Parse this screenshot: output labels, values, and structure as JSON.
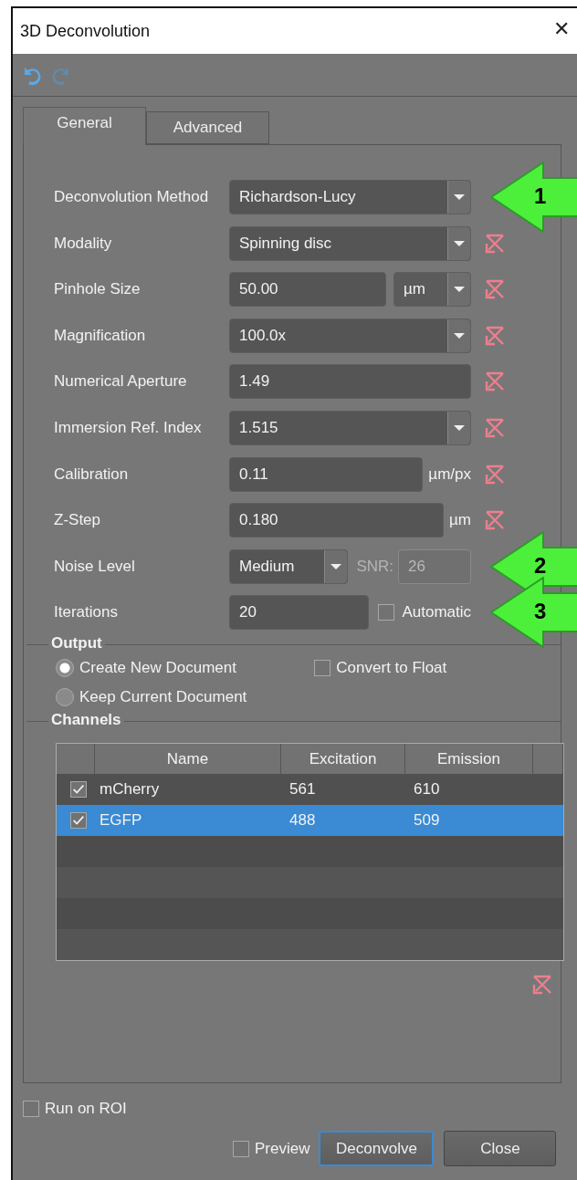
{
  "window": {
    "title": "3D Deconvolution",
    "close_label": "✕"
  },
  "toolbar": [
    {
      "kind": "undo",
      "disabled": false
    },
    {
      "kind": "redo",
      "disabled": true
    }
  ],
  "tabs": [
    {
      "label": "General",
      "selected": true
    },
    {
      "label": "Advanced",
      "selected": false
    }
  ],
  "rows": [
    {
      "label": "Deconvolution Method",
      "kind": "combo",
      "value": "Richardson-Lucy",
      "reset": false,
      "callout": "1"
    },
    {
      "label": "Modality",
      "kind": "combo",
      "value": "Spinning disc",
      "reset": true
    },
    {
      "label": "Pinhole Size",
      "kind": "input_unit_combo",
      "value": "50.00",
      "unit": "µm",
      "reset": true
    },
    {
      "label": "Magnification",
      "kind": "combo",
      "value": "100.0x",
      "reset": true
    },
    {
      "label": "Numerical Aperture",
      "kind": "input",
      "value": "1.49",
      "reset": true
    },
    {
      "label": "Immersion Ref. Index",
      "kind": "combo",
      "value": "1.515",
      "reset": true
    },
    {
      "label": "Calibration",
      "kind": "input_unit",
      "value": "0.11",
      "unit": "µm/px",
      "reset": true
    },
    {
      "label": "Z-Step",
      "kind": "input_unit",
      "value": "0.180",
      "unit": "µm",
      "reset": true
    },
    {
      "label": "Noise Level",
      "kind": "noise",
      "value": "Medium",
      "snr_label": "SNR:",
      "snr_value": "26",
      "snr_disabled": true,
      "reset": false,
      "callout": "2"
    },
    {
      "label": "Iterations",
      "kind": "iterations",
      "value": "20",
      "check_label": "Automatic",
      "checked": false,
      "reset": false,
      "callout": "3"
    }
  ],
  "output": {
    "title": "Output",
    "radios": [
      {
        "label": "Create New Document",
        "selected": true
      },
      {
        "label": "Keep Current Document",
        "selected": false
      }
    ],
    "convert": {
      "label": "Convert to Float",
      "checked": false
    }
  },
  "channels": {
    "title": "Channels",
    "columns": [
      "Name",
      "Excitation",
      "Emission"
    ],
    "rows": [
      {
        "checked": true,
        "selected": false,
        "cells": [
          "mCherry",
          "561",
          "610"
        ]
      },
      {
        "checked": true,
        "selected": true,
        "cells": [
          "EGFP",
          "488",
          "509"
        ]
      }
    ],
    "reset": true
  },
  "run_on_roi": {
    "label": "Run on ROI",
    "checked": false
  },
  "preview": {
    "label": "Preview",
    "checked": false
  },
  "buttons": [
    {
      "label": "Deconvolve",
      "focused": true
    },
    {
      "label": "Close",
      "focused": false
    }
  ]
}
